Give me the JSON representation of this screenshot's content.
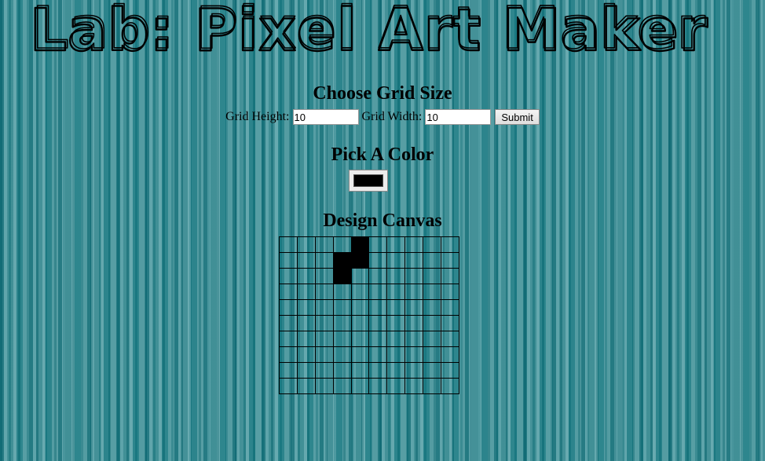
{
  "title": "Lab: Pixel Art Maker",
  "grid_section": {
    "heading": "Choose Grid Size",
    "height_label": "Grid Height:",
    "height_value": "10",
    "width_label": "Grid Width:",
    "width_value": "10",
    "submit_label": "Submit"
  },
  "color_section": {
    "heading": "Pick A Color",
    "selected_color": "#000000"
  },
  "canvas_section": {
    "heading": "Design Canvas",
    "rows": 10,
    "cols": 10,
    "filled_cells": [
      [
        0,
        4
      ],
      [
        1,
        3
      ],
      [
        1,
        4
      ],
      [
        2,
        3
      ]
    ],
    "fill_color": "#000000"
  }
}
